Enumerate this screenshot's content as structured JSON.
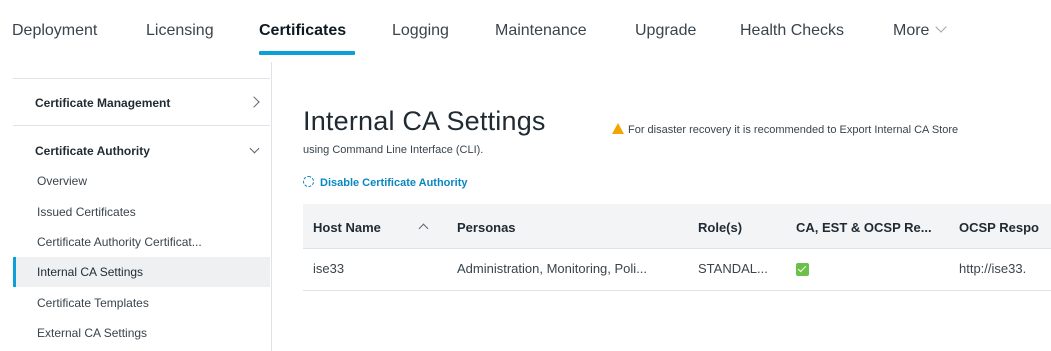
{
  "tabs": [
    {
      "label": "Deployment"
    },
    {
      "label": "Licensing"
    },
    {
      "label": "Certificates"
    },
    {
      "label": "Logging"
    },
    {
      "label": "Maintenance"
    },
    {
      "label": "Upgrade"
    },
    {
      "label": "Health Checks"
    },
    {
      "label": "More"
    }
  ],
  "active_tab": "Certificates",
  "sidebar": {
    "sections": [
      {
        "label": "Certificate Management",
        "icon": "chevron-right-icon"
      },
      {
        "label": "Certificate Authority",
        "icon": "chevron-down-icon"
      }
    ],
    "items": [
      {
        "label": "Overview"
      },
      {
        "label": "Issued Certificates"
      },
      {
        "label": "Certificate Authority Certificat..."
      },
      {
        "label": "Internal CA Settings"
      },
      {
        "label": "Certificate Templates"
      },
      {
        "label": "External CA Settings"
      }
    ],
    "selected_item": "Internal CA Settings",
    "accent_color": "#0d9fd8"
  },
  "main": {
    "title": "Internal CA Settings",
    "warning_line1": "For disaster recovery it is recommended to Export Internal CA Store",
    "warning_line2": "using Command Line Interface (CLI).",
    "warning_icon": "warning-triangle-icon",
    "disable_link": "Disable Certificate Authority",
    "table": {
      "columns": [
        "Host Name",
        "Personas",
        "Role(s)",
        "CA, EST & OCSP Re...",
        "OCSP Respo"
      ],
      "sort_icon": "sort-asc-icon",
      "rows": [
        {
          "host_name": "ise33",
          "personas": "Administration, Monitoring, Poli...",
          "roles": "STANDAL...",
          "ca_est_ocsp": true,
          "ocsp_responder": "http://ise33."
        }
      ]
    }
  }
}
